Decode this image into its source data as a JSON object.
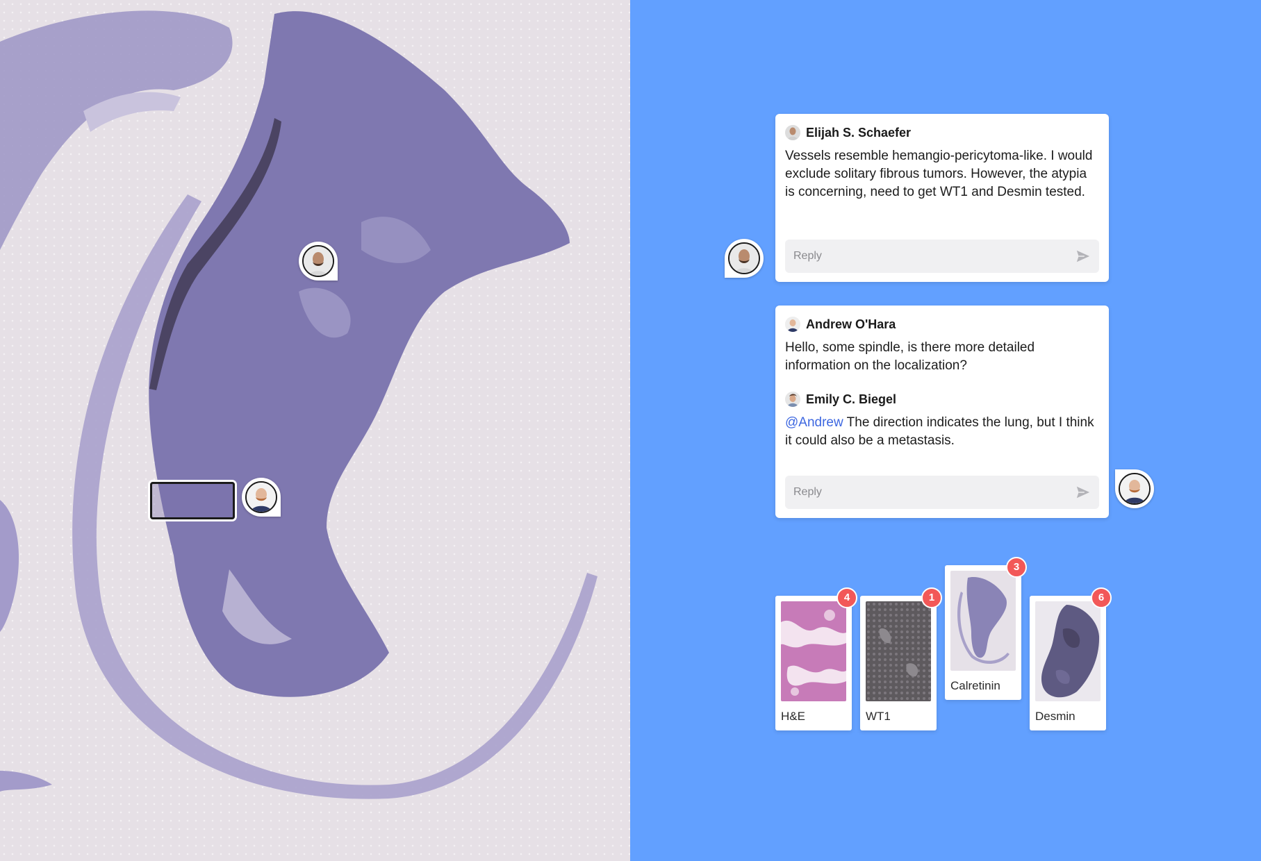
{
  "comments": [
    {
      "author": "Elijah S. Schaefer",
      "message": "Vessels resemble hemangio-pericytoma-like. I would exclude solitary fibrous tumors. However, the atypia is concerning, need to get WT1 and Desmin tested.",
      "reply_placeholder": "Reply"
    },
    {
      "author": "Andrew O'Hara",
      "message": "Hello, some spindle, is there more detailed information on the localization?",
      "reply_author": "Emily C. Biegel",
      "reply_mention": "@Andrew",
      "reply_message": " The direction indicates the lung, but I think it could also be a metastasis.",
      "reply_placeholder": "Reply"
    }
  ],
  "thumbnails": [
    {
      "label": "H&E",
      "badge": "4"
    },
    {
      "label": "WT1",
      "badge": "1"
    },
    {
      "label": "Calretinin",
      "badge": "3"
    },
    {
      "label": "Desmin",
      "badge": "6"
    }
  ],
  "colors": {
    "background": "#62a0ff",
    "tissue": "#7f78b0",
    "badge": "#f25858",
    "mention": "#3d67e0"
  },
  "icons": [
    "send-icon",
    "avatar-pin",
    "region-annotation"
  ]
}
